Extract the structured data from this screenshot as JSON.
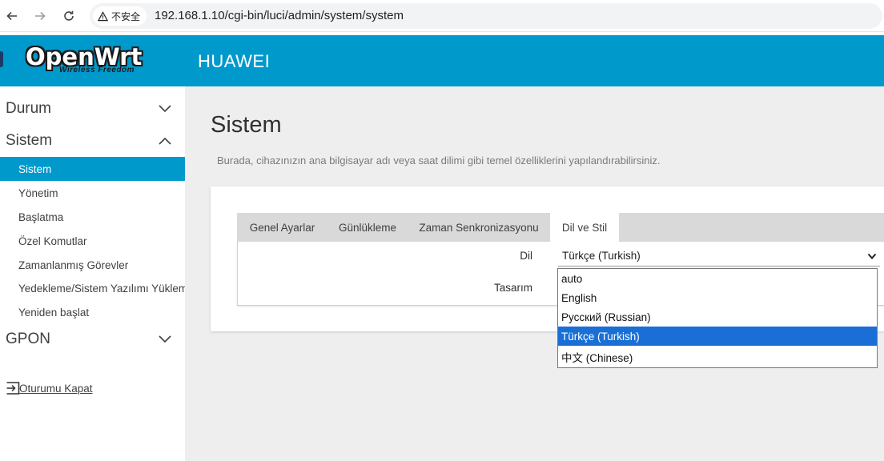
{
  "browser": {
    "security_label": "不安全",
    "url": "192.168.1.10/cgi-bin/luci/admin/system/system"
  },
  "header": {
    "logo_main": "OpenWrt",
    "logo_sub": "Wireless Freedom",
    "hostname": "HUAWEI",
    "accent_color": "#0099cc"
  },
  "sidebar": {
    "categories": [
      {
        "label": "Durum",
        "expanded": false
      },
      {
        "label": "Sistem",
        "expanded": true
      },
      {
        "label": "GPON",
        "expanded": false
      }
    ],
    "items": [
      {
        "label": "Sistem",
        "active": true
      },
      {
        "label": "Yönetim"
      },
      {
        "label": "Başlatma"
      },
      {
        "label": "Özel Komutlar"
      },
      {
        "label": "Zamanlanmış Görevler"
      },
      {
        "label": "Yedekleme/Sistem Yazılımı Yükleme"
      },
      {
        "label": "Yeniden başlat"
      }
    ],
    "logout_label": "Oturumu Kapat"
  },
  "main": {
    "title": "Sistem",
    "description": "Burada, cihazınızın ana bilgisayar adı veya saat dilimi gibi temel özelliklerini yapılandırabilirsiniz.",
    "tabs": [
      {
        "label": "Genel Ayarlar"
      },
      {
        "label": "Günlükleme"
      },
      {
        "label": "Zaman Senkronizasyonu"
      },
      {
        "label": "Dil ve Stil",
        "active": true
      }
    ],
    "fields": {
      "language_label": "Dil",
      "language_value": "Türkçe (Turkish)",
      "theme_label": "Tasarım"
    }
  },
  "dropdown": {
    "options": [
      {
        "label": "auto"
      },
      {
        "label": "English"
      },
      {
        "label": "Русский (Russian)"
      },
      {
        "label": "Türkçe (Turkish)",
        "selected": true
      },
      {
        "label": "中文 (Chinese)"
      }
    ],
    "selected_color": "#1a6fd6"
  }
}
